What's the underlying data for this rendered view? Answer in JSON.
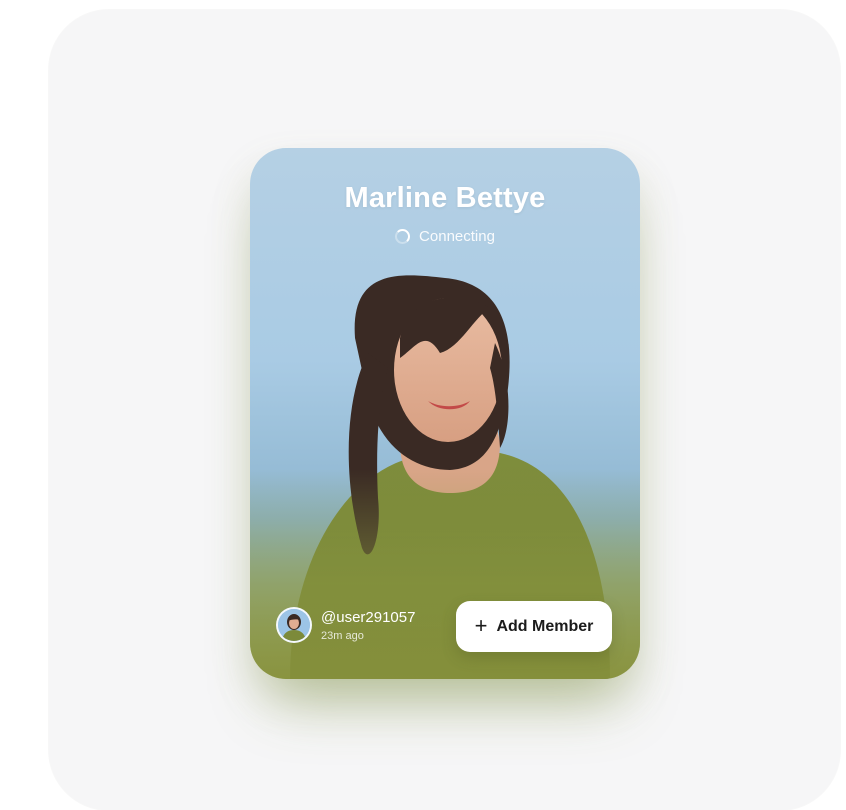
{
  "call": {
    "contact_name": "Marline Bettye",
    "status": "Connecting",
    "status_icon": "spinner-icon"
  },
  "footer": {
    "username": "@user291057",
    "timestamp": "23m ago",
    "add_member_label": "Add Member",
    "add_member_icon": "+"
  },
  "colors": {
    "sky": "#a9cbe4",
    "sweater": "#7c8a3a",
    "button_bg": "#ffffff",
    "button_text": "#1b1b1b",
    "page_bg": "#f6f6f7"
  }
}
